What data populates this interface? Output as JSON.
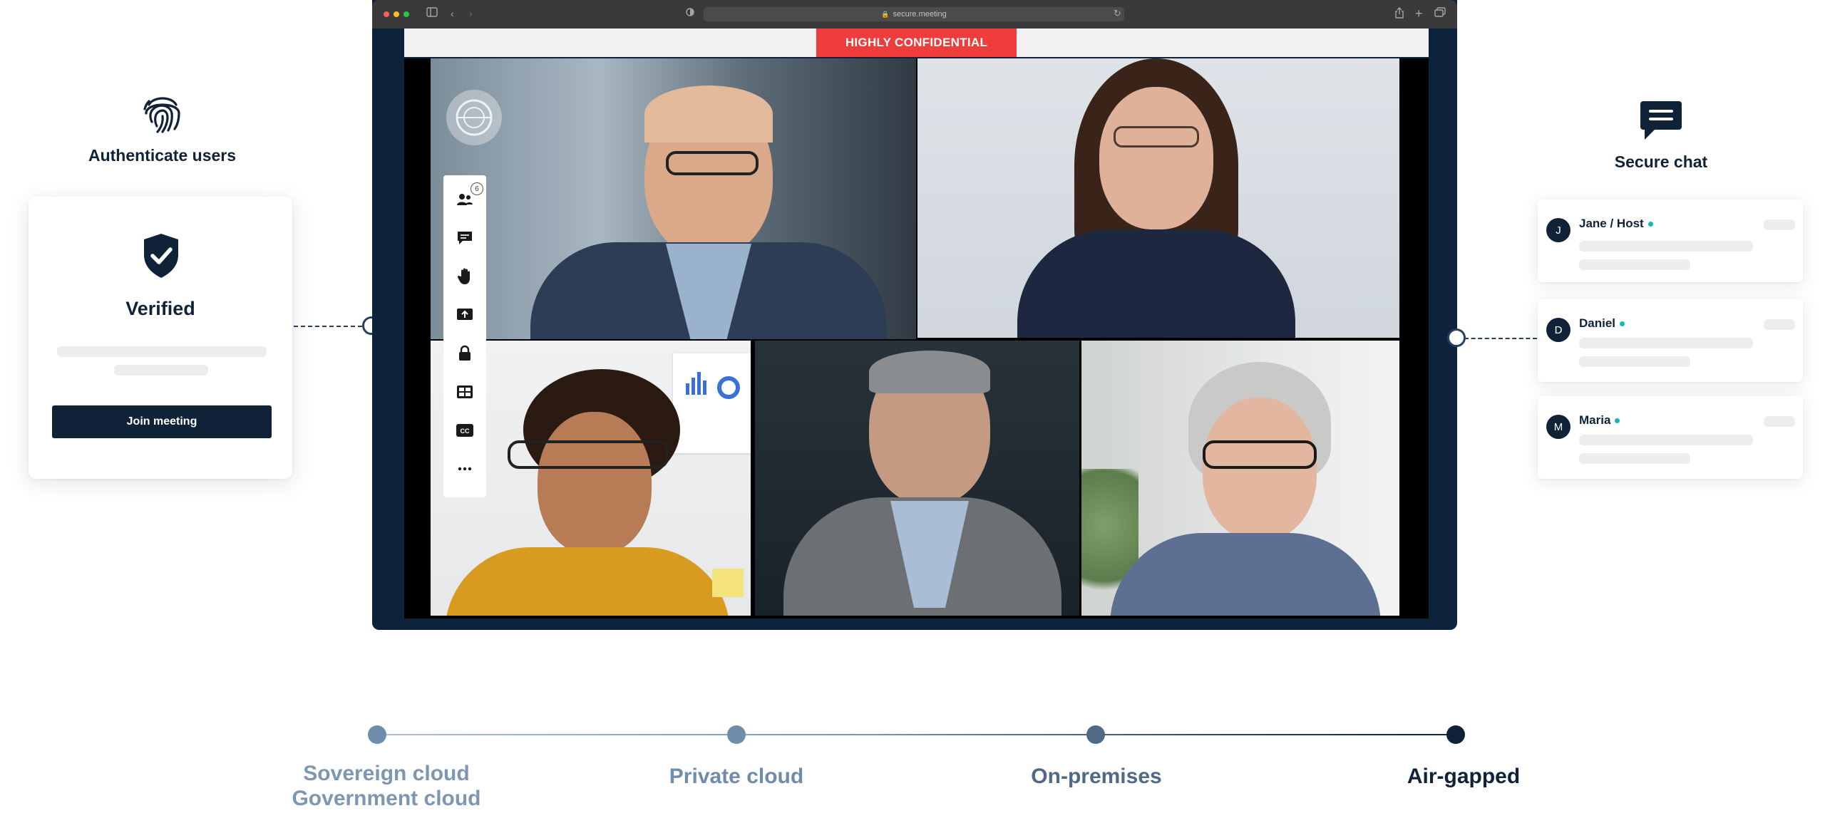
{
  "left_feature": {
    "label": "Authenticate users",
    "icon": "fingerprint-icon"
  },
  "verify_card": {
    "title": "Verified",
    "join_button": "Join meeting",
    "icon": "shield-check-icon"
  },
  "browser": {
    "url": "secure.meeting",
    "banner": "HIGHLY CONFIDENTIAL",
    "banner_color": "#ef3c3c",
    "participant_count": "6",
    "tools": [
      "participants-icon",
      "chat-icon",
      "raise-hand-icon",
      "share-screen-icon",
      "lock-icon",
      "layout-icon",
      "captions-icon",
      "more-icon"
    ],
    "captions_label": "CC"
  },
  "right_feature": {
    "label": "Secure chat",
    "icon": "chat-bubble-icon"
  },
  "chat": [
    {
      "initial": "J",
      "name": "Jane / Host"
    },
    {
      "initial": "D",
      "name": "Daniel"
    },
    {
      "initial": "M",
      "name": "Maria"
    }
  ],
  "timeline": {
    "stops": [
      {
        "line1": "Sovereign cloud",
        "line2": "Government cloud"
      },
      {
        "line1": "Private cloud"
      },
      {
        "line1": "On-premises"
      },
      {
        "line1": "Air-gapped"
      }
    ]
  },
  "colors": {
    "navy": "#0f2238",
    "accent_online": "#16b8b3",
    "timeline_light": "#6f8cab",
    "timeline_dark": "#0f2238"
  }
}
